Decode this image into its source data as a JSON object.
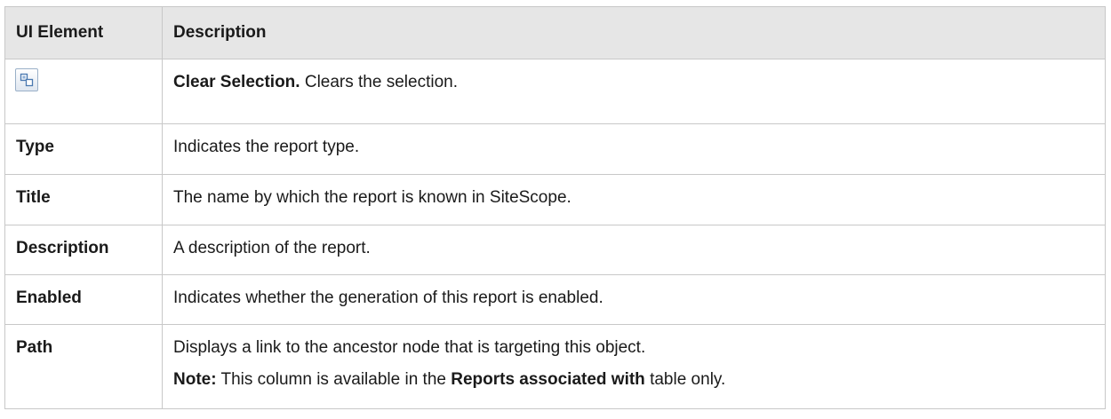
{
  "header": {
    "col1": "UI Element",
    "col2": "Description"
  },
  "rows": [
    {
      "element_icon": "clear-selection-icon",
      "desc_bold": "Clear Selection.",
      "desc_rest": " Clears the selection."
    },
    {
      "element": "Type",
      "desc": "Indicates the report type."
    },
    {
      "element": "Title",
      "desc": "The name by which the report is known in SiteScope."
    },
    {
      "element": "Description",
      "desc": "A description of the report."
    },
    {
      "element": "Enabled",
      "desc": "Indicates whether the generation of this report is enabled."
    },
    {
      "element": "Path",
      "desc": "Displays a link to the ancestor node that is targeting this object.",
      "note_label": "Note:",
      "note_text_1": " This column is available in the ",
      "note_bold": "Reports associated with",
      "note_text_2": " table only."
    }
  ],
  "colors": {
    "header_bg": "#e6e6e6",
    "border": "#c8c8c8",
    "icon_blue": "#4a78b0"
  }
}
